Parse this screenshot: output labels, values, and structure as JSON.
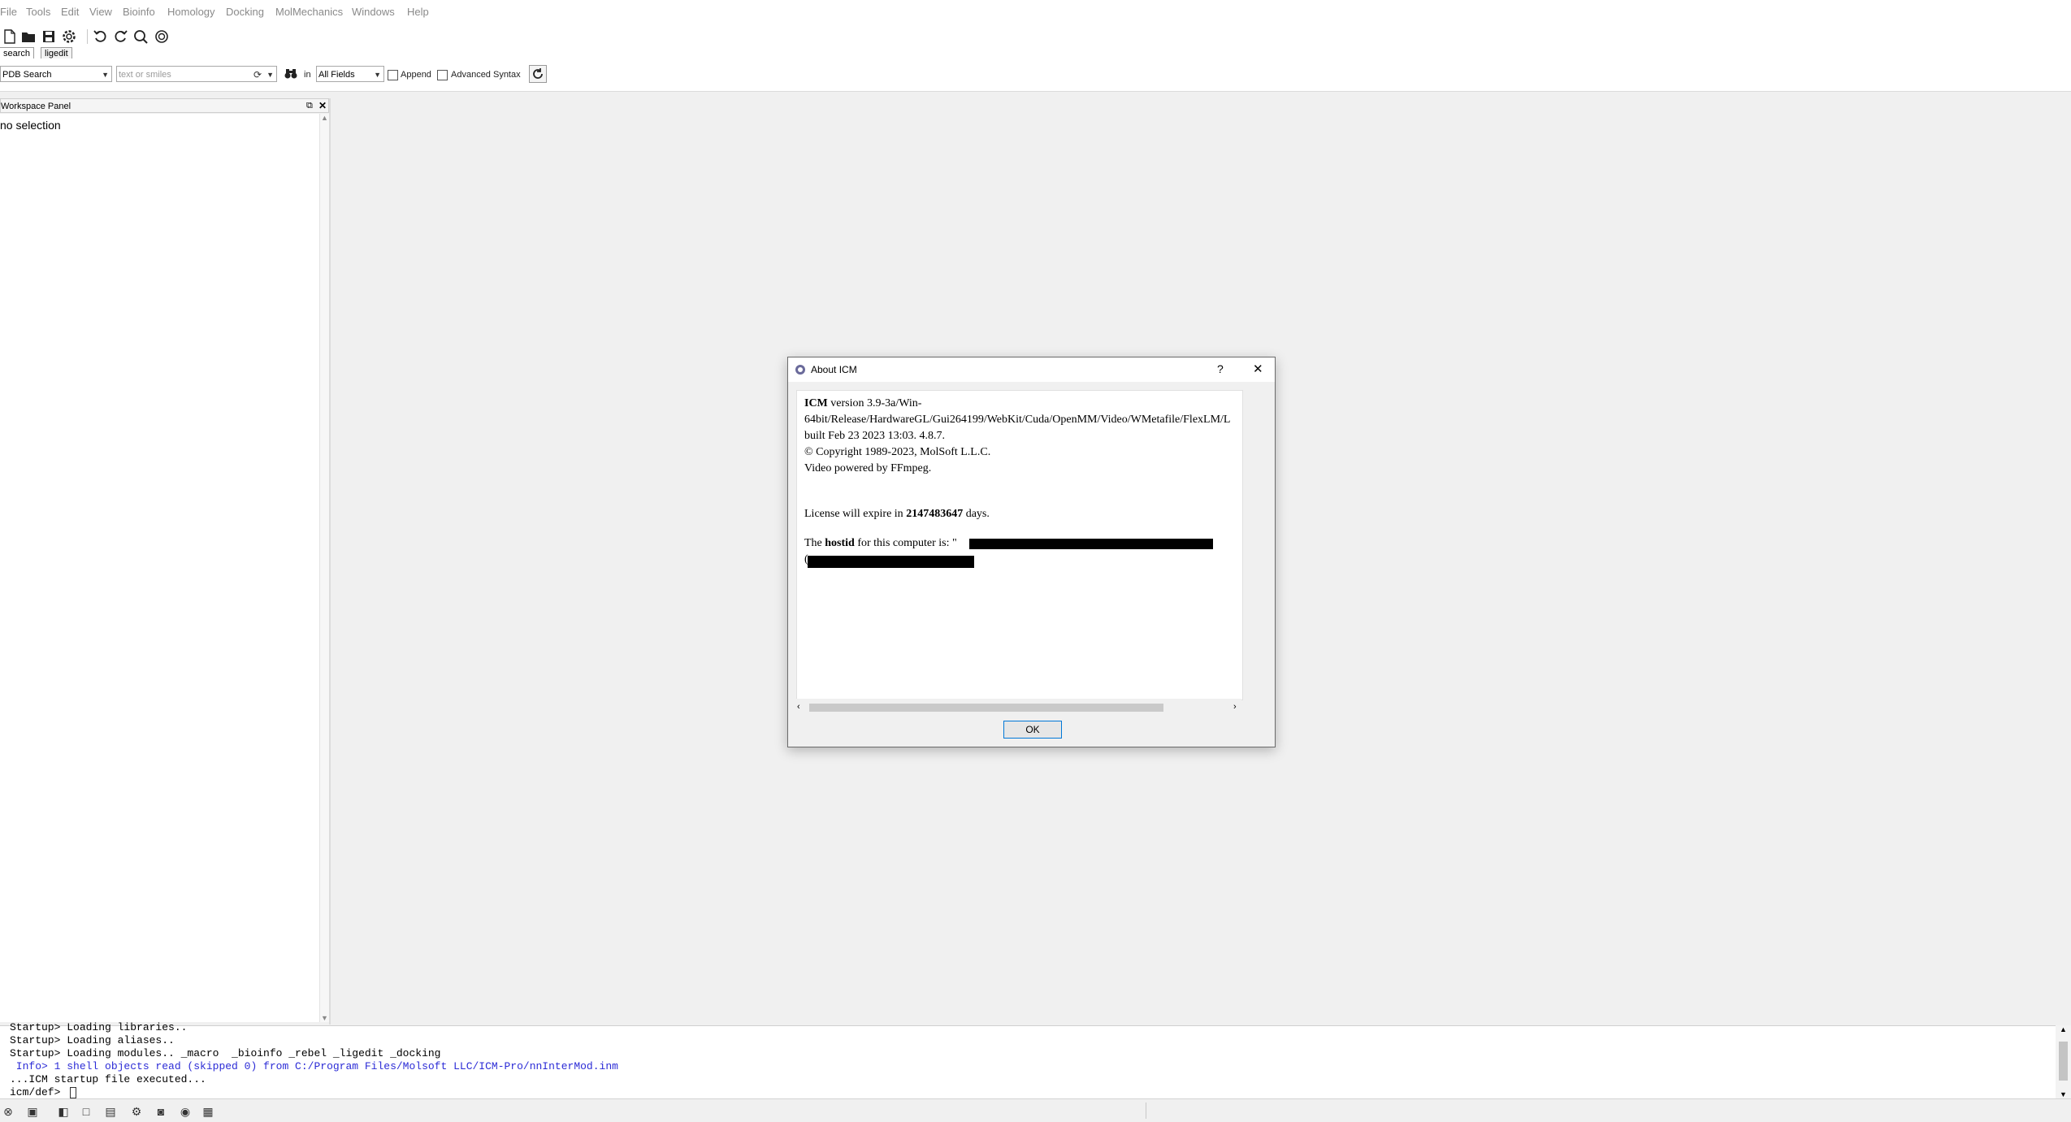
{
  "menu": [
    "File",
    "Tools",
    "Edit",
    "View",
    "Bioinfo",
    "Homology",
    "Docking",
    "MolMechanics",
    "Windows",
    "Help"
  ],
  "toolbar_icons": [
    "new-file-icon",
    "open-folder-icon",
    "save-icon",
    "settings-gear-icon",
    "undo-icon",
    "redo-icon",
    "refresh-search-icon",
    "help-icon"
  ],
  "tabs": {
    "search": "search",
    "ligedit": "ligedit"
  },
  "search": {
    "source": "PDB Search",
    "query_placeholder": "text or smiles",
    "in_label": "in",
    "field": "All Fields",
    "append": "Append",
    "advanced": "Advanced Syntax"
  },
  "workspace": {
    "title": "Workspace Panel",
    "selection_text": "no selection"
  },
  "console": {
    "lines": [
      "Startup> Loading libraries..",
      "Startup> Loading aliases..",
      "Startup> Loading modules.. _macro  _bioinfo _rebel _ligedit _docking",
      " Info> 1 shell objects read (skipped 0) from C:/Program Files/Molsoft LLC/ICM-Pro/nnInterMod.inm",
      "...ICM startup file executed...",
      "icm/def> "
    ],
    "info_color": "#2b2bd6"
  },
  "dialog": {
    "title": "About ICM",
    "help": "?",
    "close": "✕",
    "line1_bold": "ICM",
    "line1_rest": " version 3.9-3a/Win-",
    "line2": "64bit/Release/HardwareGL/Gui264199/WebKit/Cuda/OpenMM/Video/WMetafile/FlexLM/L",
    "line3": "built Feb 23 2023 13:03. 4.8.7.",
    "line4": "© Copyright 1989-2023, MolSoft L.L.C.",
    "line5": "Video powered by FFmpeg.",
    "license_pre": "License will expire in ",
    "license_days": "2147483647",
    "license_post": " days.",
    "host_pre": "The ",
    "host_bold": "hostid",
    "host_post": " for this computer is: \"",
    "host_line2_start": "(",
    "ok": "OK"
  }
}
